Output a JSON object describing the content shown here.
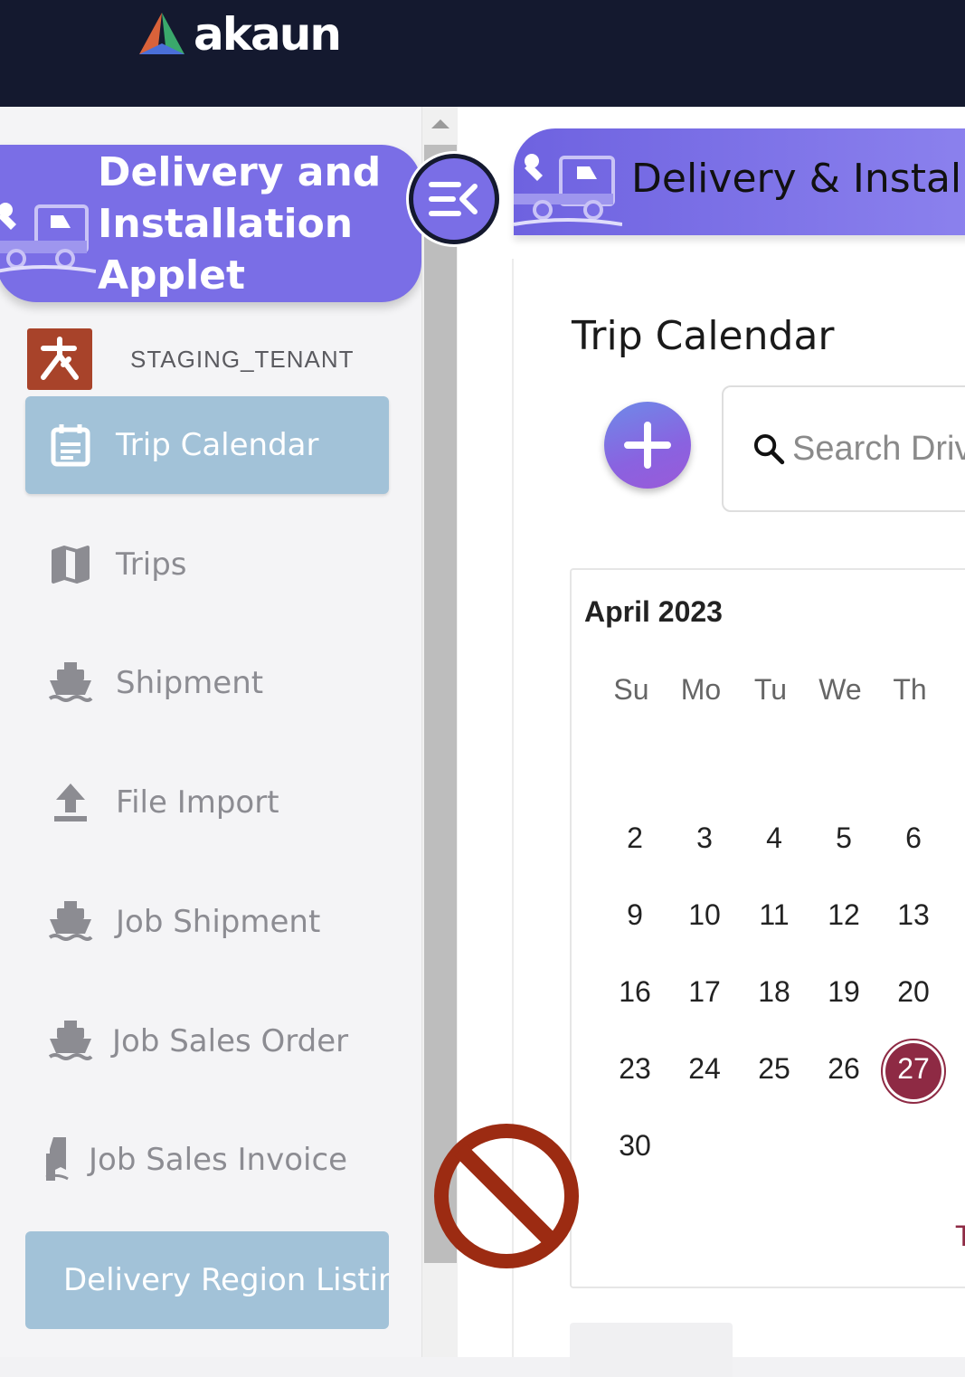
{
  "app": {
    "brand": "akaun"
  },
  "sidebar": {
    "applet_title": "Delivery and Installation Applet",
    "tenant": "STAGING_TENANT",
    "items": [
      {
        "label": "Trip Calendar",
        "icon": "calendar-icon",
        "active": true
      },
      {
        "label": "Trips",
        "icon": "map-icon"
      },
      {
        "label": "Shipment",
        "icon": "ship-icon"
      },
      {
        "label": "File Import",
        "icon": "upload-icon"
      },
      {
        "label": "Job Shipment",
        "icon": "ship-icon"
      },
      {
        "label": "Job Sales Order",
        "icon": "ship-icon"
      },
      {
        "label": "Job Sales Invoice",
        "icon": "receipt-icon"
      },
      {
        "label": "Delivery Region Listing"
      }
    ]
  },
  "main": {
    "header_title": "Delivery & Installation Applet",
    "page_title": "Trip Calendar",
    "search_placeholder": "Search Driver"
  },
  "calendar": {
    "month": "April 2023",
    "weekdays": [
      "Su",
      "Mo",
      "Tu",
      "We",
      "Th"
    ],
    "weeks": [
      [
        "2",
        "3",
        "4",
        "5",
        "6"
      ],
      [
        "9",
        "10",
        "11",
        "12",
        "13"
      ],
      [
        "16",
        "17",
        "18",
        "19",
        "20"
      ],
      [
        "23",
        "24",
        "25",
        "26",
        "27"
      ],
      [
        "30"
      ]
    ],
    "selected": "27",
    "cut_off_marker": "T"
  },
  "colors": {
    "topbar": "#14192f",
    "accent": "#7a6ee6",
    "active_nav": "#a2c2d8",
    "selected_day": "#8e2a44",
    "blocked_cursor": "#9c2b12"
  }
}
